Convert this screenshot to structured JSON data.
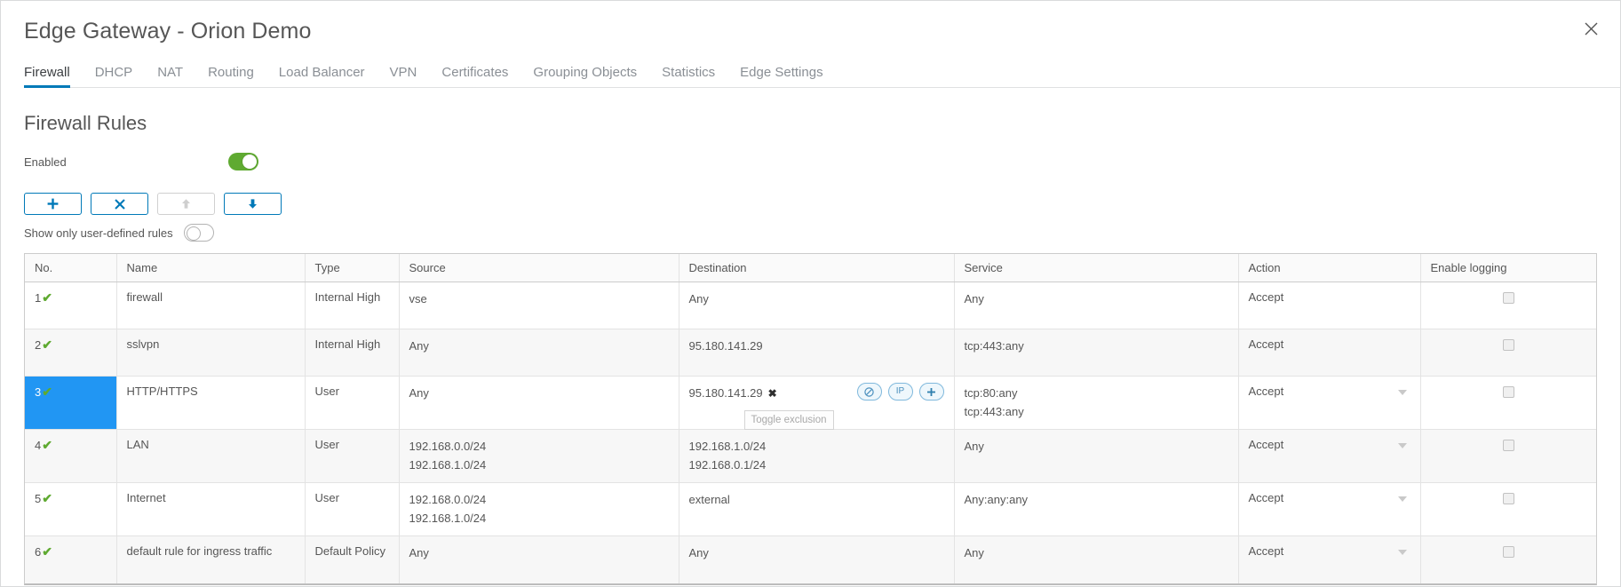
{
  "window": {
    "title": "Edge Gateway - Orion Demo",
    "close_icon": "close-icon"
  },
  "tabs": [
    {
      "label": "Firewall",
      "active": true
    },
    {
      "label": "DHCP",
      "active": false
    },
    {
      "label": "NAT",
      "active": false
    },
    {
      "label": "Routing",
      "active": false
    },
    {
      "label": "Load Balancer",
      "active": false
    },
    {
      "label": "VPN",
      "active": false
    },
    {
      "label": "Certificates",
      "active": false
    },
    {
      "label": "Grouping Objects",
      "active": false
    },
    {
      "label": "Statistics",
      "active": false
    },
    {
      "label": "Edge Settings",
      "active": false
    }
  ],
  "section": {
    "title": "Firewall Rules",
    "enabled_label": "Enabled",
    "enabled_state": "on",
    "filter_label": "Show only user-defined rules",
    "filter_state": "off"
  },
  "toolbar": {
    "add_label": "+",
    "delete_label": "×",
    "move_up_label": "↑",
    "move_down_label": "↓"
  },
  "table": {
    "headers": [
      "No.",
      "Name",
      "Type",
      "Source",
      "Destination",
      "Service",
      "Action",
      "Enable logging"
    ],
    "rows": [
      {
        "no": "1",
        "enabled_check": "✔",
        "name": "firewall",
        "type": "Internal High",
        "source": [
          "vse"
        ],
        "destination": [
          "Any"
        ],
        "service": [
          "Any"
        ],
        "action": "Accept",
        "has_caret": false,
        "logging_checked": false,
        "selected": false
      },
      {
        "no": "2",
        "enabled_check": "✔",
        "name": "sslvpn",
        "type": "Internal High",
        "source": [
          "Any"
        ],
        "destination": [
          "95.180.141.29"
        ],
        "service": [
          "tcp:443:any"
        ],
        "action": "Accept",
        "has_caret": false,
        "logging_checked": false,
        "selected": false
      },
      {
        "no": "3",
        "enabled_check": "✔",
        "name": "HTTP/HTTPS",
        "type": "User",
        "source": [
          "Any"
        ],
        "destination": [
          "95.180.141.29"
        ],
        "destination_remove": "✖",
        "service": [
          "tcp:80:any",
          "tcp:443:any"
        ],
        "action": "Accept",
        "has_caret": true,
        "logging_checked": false,
        "selected": true,
        "pills": [
          {
            "name": "toggle-exclusion-icon",
            "label": "⊘"
          },
          {
            "name": "ip-button",
            "label": "IP"
          },
          {
            "name": "add-button",
            "label": "+"
          }
        ],
        "tooltip": "Toggle exclusion"
      },
      {
        "no": "4",
        "enabled_check": "✔",
        "name": "LAN",
        "type": "User",
        "source": [
          "192.168.0.0/24",
          "192.168.1.0/24"
        ],
        "destination": [
          "192.168.1.0/24",
          "192.168.0.1/24"
        ],
        "service": [
          "Any"
        ],
        "action": "Accept",
        "has_caret": true,
        "logging_checked": false,
        "selected": false
      },
      {
        "no": "5",
        "enabled_check": "✔",
        "name": "Internet",
        "type": "User",
        "source": [
          "192.168.0.0/24",
          "192.168.1.0/24"
        ],
        "destination": [
          "external"
        ],
        "service": [
          "Any:any:any"
        ],
        "action": "Accept",
        "has_caret": true,
        "logging_checked": false,
        "selected": false
      },
      {
        "no": "6",
        "enabled_check": "✔",
        "name": "default rule for ingress traffic",
        "type": "Default Policy",
        "source": [
          "Any"
        ],
        "destination": [
          "Any"
        ],
        "service": [
          "Any"
        ],
        "action": "Accept",
        "has_caret": true,
        "logging_checked": false,
        "selected": false
      }
    ]
  },
  "colors": {
    "accent": "#0079b8",
    "toggle_on": "#5faa31",
    "selection": "#2196f3",
    "check": "#5faa31"
  }
}
